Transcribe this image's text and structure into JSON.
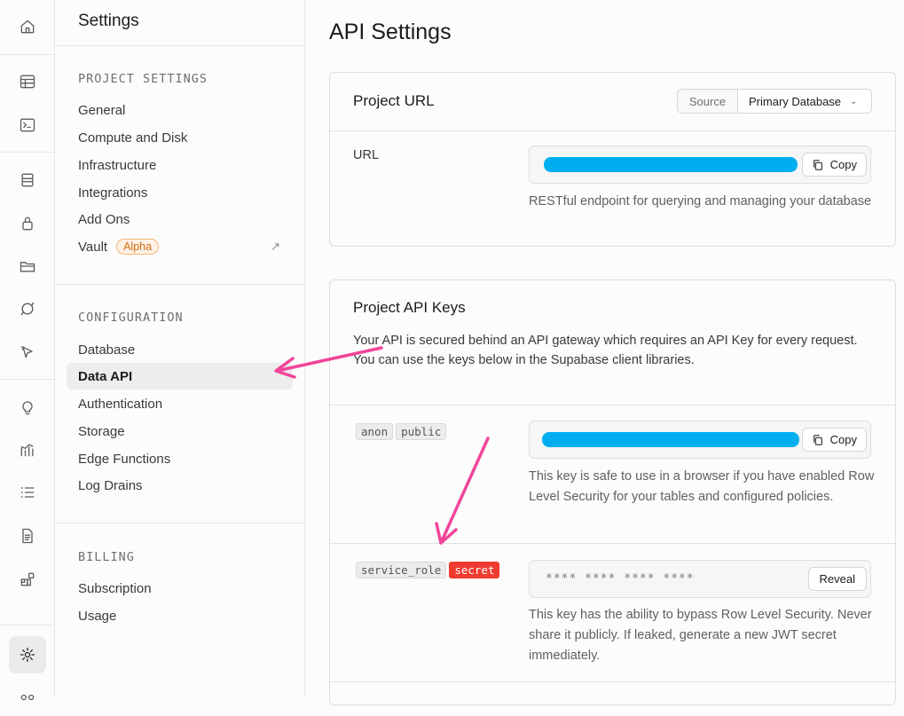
{
  "rail": {
    "icons": [
      "home-icon",
      "table-editor-icon",
      "sql-editor-icon",
      "database-icon",
      "auth-lock-icon",
      "storage-folder-icon",
      "realtime-icon",
      "edge-functions-icon",
      "advisors-bulb-icon",
      "reports-icon",
      "logs-list-icon",
      "docs-file-icon",
      "integrations-blocks-icon",
      "settings-gear-icon",
      "more-icon"
    ]
  },
  "menu": {
    "title": "Settings",
    "project_settings": {
      "heading": "PROJECT SETTINGS",
      "items": [
        "General",
        "Compute and Disk",
        "Infrastructure",
        "Integrations",
        "Add Ons",
        "Vault"
      ],
      "vault_badge": "Alpha",
      "vault_ext_icon": "↗"
    },
    "configuration": {
      "heading": "CONFIGURATION",
      "items": [
        "Database",
        "Data API",
        "Authentication",
        "Storage",
        "Edge Functions",
        "Log Drains"
      ],
      "active": "Data API"
    },
    "billing": {
      "heading": "BILLING",
      "items": [
        "Subscription",
        "Usage"
      ]
    }
  },
  "page": {
    "title": "API Settings"
  },
  "project_url": {
    "title": "Project URL",
    "source_label": "Source",
    "source_value": "Primary Database",
    "url_label": "URL",
    "copy_label": "Copy",
    "help": "RESTful endpoint for querying and managing your database"
  },
  "api_keys": {
    "title": "Project API Keys",
    "desc_line1": "Your API is secured behind an API gateway which requires an API Key for every request.",
    "desc_line2": "You can use the keys below in the Supabase client libraries.",
    "anon": {
      "tags": [
        "anon",
        "public"
      ],
      "copy_label": "Copy",
      "help": "This key is safe to use in a browser if you have enabled Row Level Security for your tables and configured policies."
    },
    "service_role": {
      "tags": [
        "service_role",
        "secret"
      ],
      "masked": "**** **** **** ****",
      "reveal_label": "Reveal",
      "help": "This key has the ability to bypass Row Level Security. Never share it publicly. If leaked, generate a new JWT secret immediately."
    }
  },
  "colors": {
    "annotation_arrow": "#f0459a",
    "redaction": "#00aeef",
    "secret_tag": "#ef3b2f",
    "alpha_badge": "#d66d12"
  }
}
